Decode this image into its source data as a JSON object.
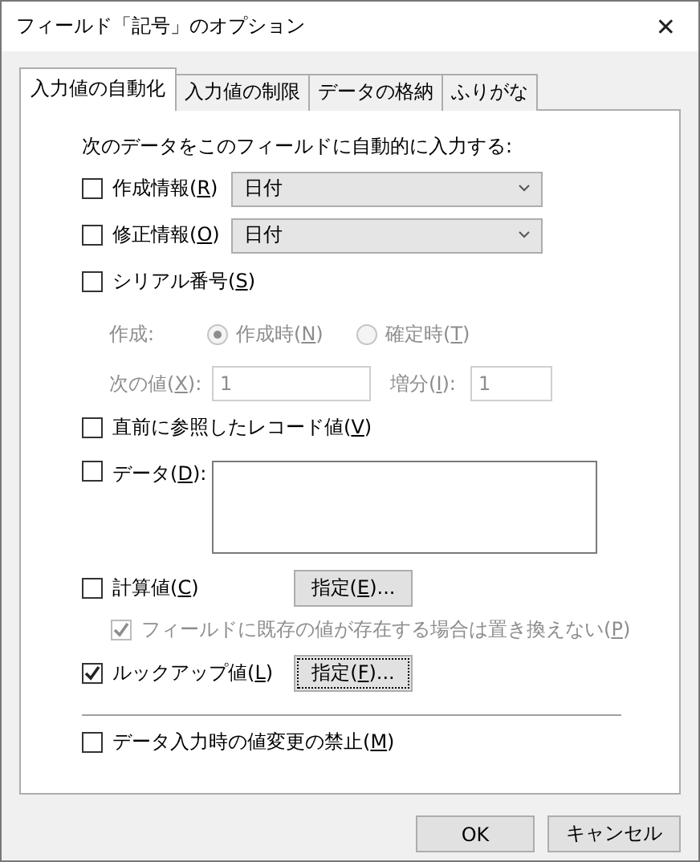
{
  "window": {
    "title": "フィールド「記号」のオプション",
    "close": "✕"
  },
  "tabs": [
    {
      "label": "入力値の自動化",
      "selected": true
    },
    {
      "label": "入力値の制限",
      "selected": false
    },
    {
      "label": "データの格納",
      "selected": false
    },
    {
      "label": "ふりがな",
      "selected": false
    }
  ],
  "heading": "次のデータをこのフィールドに自動的に入力する:",
  "rows": [
    {
      "kind": "select",
      "label": "作成情報(R)",
      "checked": false,
      "value": "日付"
    },
    {
      "kind": "select",
      "label": "修正情報(O)",
      "checked": false,
      "value": "日付"
    },
    {
      "kind": "check",
      "label": "シリアル番号(S)",
      "checked": false
    },
    {
      "kind": "radios",
      "label": "作成:",
      "disabled": true,
      "options": [
        {
          "label": "作成時(N)",
          "selected": true
        },
        {
          "label": "確定時(T)",
          "selected": false
        }
      ]
    },
    {
      "kind": "numbers",
      "disabled": true,
      "fields": [
        {
          "label": "次の値(X):",
          "value": "1"
        },
        {
          "label": "増分(I):",
          "value": "1"
        }
      ]
    },
    {
      "kind": "check",
      "label": "直前に参照したレコード値(V)",
      "checked": false
    },
    {
      "kind": "textarea",
      "label": "データ(D):",
      "checked": false
    },
    {
      "kind": "button",
      "label": "計算値(C)",
      "checked": false,
      "button": "指定(E)...",
      "focused": false
    },
    {
      "kind": "sub",
      "label": "フィールドに既存の値が存在する場合は置き換えない(P)",
      "checked": true,
      "disabled": true
    },
    {
      "kind": "button",
      "label": "ルックアップ値(L)",
      "checked": true,
      "button": "指定(F)...",
      "focused": true
    },
    {
      "kind": "separator"
    },
    {
      "kind": "check",
      "label": "データ入力時の値変更の禁止(M)",
      "checked": false
    }
  ],
  "buttons": [
    {
      "label": "OK"
    },
    {
      "label": "キャンセル"
    }
  ]
}
